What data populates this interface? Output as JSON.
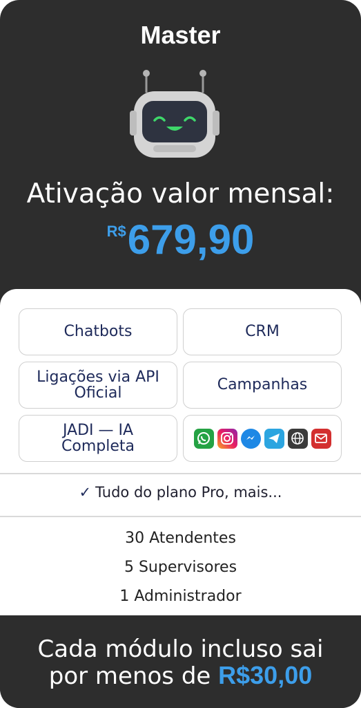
{
  "plan": {
    "title": "Master",
    "activation_label": "Ativação valor mensal:",
    "price_currency": "R$",
    "price_value": "679,90"
  },
  "features": {
    "chatbots": "Chatbots",
    "crm": "CRM",
    "ligacoes_line1": "Ligações via API",
    "ligacoes_line2": "Oficial",
    "campanhas": "Campanhas",
    "jadi_line1": "JADI — IA",
    "jadi_line2": "Completa",
    "channels": [
      "whatsapp-icon",
      "instagram-icon",
      "messenger-icon",
      "telegram-icon",
      "web-icon",
      "email-icon"
    ]
  },
  "includes": {
    "check_text": "Tudo do plano Pro, mais..."
  },
  "limits": [
    "30 Atendentes",
    "5 Supervisores",
    "1 Administrador"
  ],
  "footer": {
    "line1": "Cada módulo incluso sai",
    "line2_prefix": "por menos de",
    "line2_value": "R$30,00"
  },
  "colors": {
    "accent": "#3d9eea",
    "background": "#2d2d2d",
    "tile_text": "#1e2a5a"
  }
}
